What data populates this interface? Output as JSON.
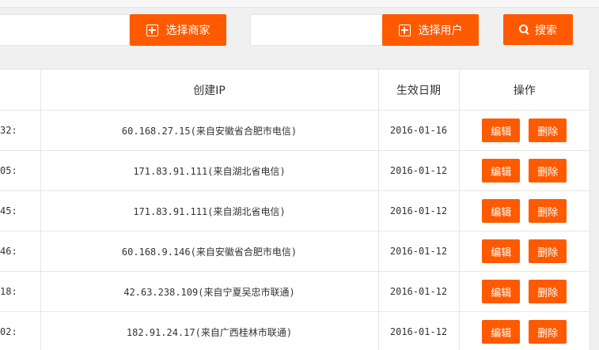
{
  "filters": {
    "merchant_input_value": "",
    "merchant_button_label": "选择商家",
    "user_input_value": "",
    "user_button_label": "选择用户",
    "search_button_label": "搜索"
  },
  "table": {
    "columns": [
      "",
      "创建IP",
      "生效日期",
      "操作"
    ],
    "rows": [
      {
        "time": ":32",
        "ip": "60.168.27.15(来自安徽省合肥市电信)",
        "date": "2016-01-16",
        "edit": "编辑",
        "delete": "删除"
      },
      {
        "time": ":05",
        "ip": "171.83.91.111(来自湖北省电信)",
        "date": "2016-01-12",
        "edit": "编辑",
        "delete": "删除"
      },
      {
        "time": ":45",
        "ip": "171.83.91.111(来自湖北省电信)",
        "date": "2016-01-12",
        "edit": "编辑",
        "delete": "删除"
      },
      {
        "time": ":46",
        "ip": "60.168.9.146(来自安徽省合肥市电信)",
        "date": "2016-01-12",
        "edit": "编辑",
        "delete": "删除"
      },
      {
        "time": ":18",
        "ip": "42.63.238.109(来自宁夏吴忠市联通)",
        "date": "2016-01-12",
        "edit": "编辑",
        "delete": "删除"
      },
      {
        "time": ":02",
        "ip": "182.91.24.17(来自广西桂林市联通)",
        "date": "2016-01-12",
        "edit": "编辑",
        "delete": "删除"
      }
    ]
  },
  "colors": {
    "accent": "#ff5a00",
    "background": "#f0f0f0",
    "border": "#e6e6e6"
  },
  "icons": {
    "merchant_button": "plus-square-icon",
    "user_button": "plus-square-icon",
    "search_button": "search-icon"
  }
}
